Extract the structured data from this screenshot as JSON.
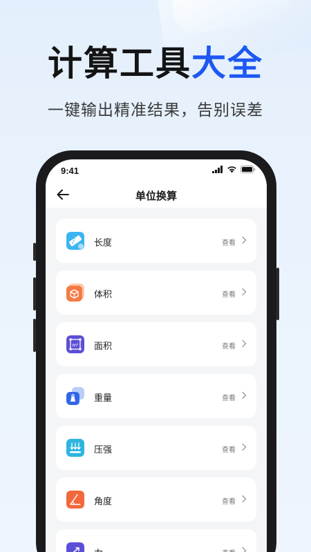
{
  "headline": {
    "part1": "计算工具",
    "part2": "大全"
  },
  "subline": "一键输出精准结果，告别误差",
  "status_bar": {
    "time": "9:41"
  },
  "nav": {
    "title": "单位换算"
  },
  "list": {
    "view_label": "查看",
    "items": [
      {
        "label": "长度",
        "icon": "ruler-icon",
        "color": "#3bb4f2"
      },
      {
        "label": "体积",
        "icon": "cube-icon",
        "color": "#f47a44"
      },
      {
        "label": "面积",
        "icon": "area-square-icon",
        "color": "#5b4fd6"
      },
      {
        "label": "重量",
        "icon": "weight-icon",
        "color": "#3167e8"
      },
      {
        "label": "压强",
        "icon": "pressure-icon",
        "color": "#2cb5df"
      },
      {
        "label": "角度",
        "icon": "angle-icon",
        "color": "#f2683a"
      },
      {
        "label": "力",
        "icon": "force-icon",
        "color": "#5a4fd6"
      }
    ]
  },
  "colors": {
    "accent": "#1d58f2",
    "background": "#e8f2fd",
    "phone_frame": "#1b1b1d"
  }
}
